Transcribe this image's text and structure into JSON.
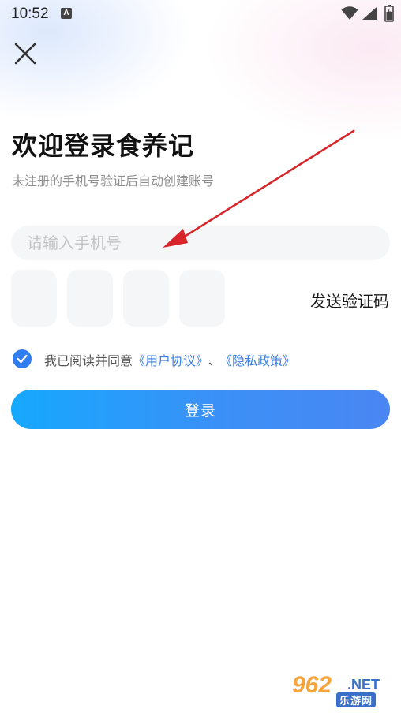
{
  "status_bar": {
    "time": "10:52",
    "notification_letter": "A",
    "icons": [
      "wifi-icon",
      "signal-icon",
      "battery-icon"
    ]
  },
  "header": {
    "close_icon": "close-icon"
  },
  "main": {
    "title": "欢迎登录食养记",
    "subtitle": "未注册的手机号验证后自动创建账号",
    "phone_placeholder": "请输入手机号",
    "phone_value": "",
    "code_boxes": [
      "",
      "",
      "",
      ""
    ],
    "send_code_label": "发送验证码"
  },
  "agreement": {
    "checked": true,
    "prefix": "我已阅读并同意",
    "user_agreement": "《用户协议》",
    "separator": "、",
    "privacy_policy": "《隐私政策》"
  },
  "login_button": {
    "label": "登录"
  },
  "watermark": {
    "number": "962",
    "suffix": ".NET",
    "site_name": "乐游网"
  },
  "colors": {
    "accent": "#2f7df0",
    "link": "#3a7de4",
    "button_gradient_start": "#16a8fd",
    "button_gradient_end": "#4a86f2",
    "annotation_arrow": "#d7262b"
  }
}
